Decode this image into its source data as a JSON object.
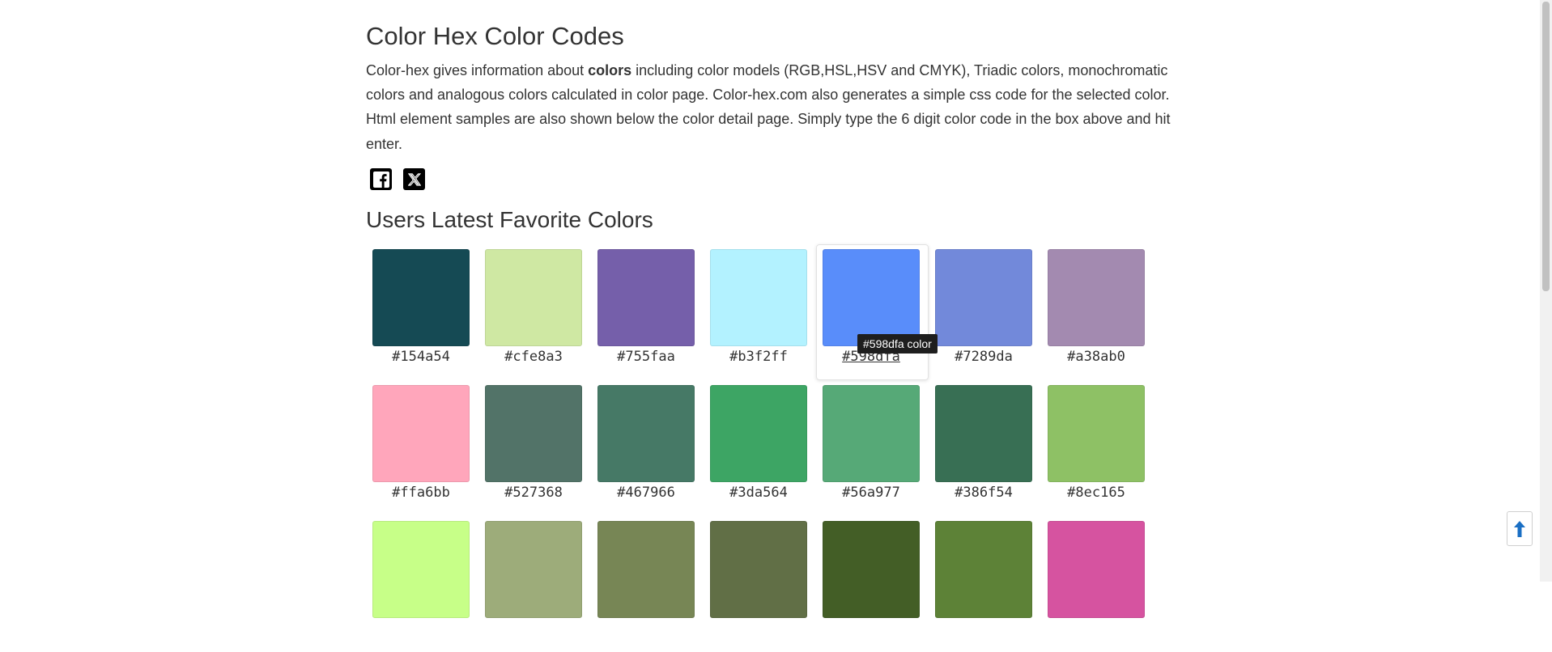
{
  "page": {
    "title": "Color Hex Color Codes",
    "intro_before": "Color-hex gives information about ",
    "intro_bold": "colors",
    "intro_after": " including color models (RGB,HSL,HSV and CMYK), Triadic colors, monochromatic colors and analogous colors calculated in color page. Color-hex.com also generates a simple css code for the selected color. Html element samples are also shown below the color detail page. Simply type the 6 digit color code in the box above and hit enter.",
    "favorites_title": "Users Latest Favorite Colors"
  },
  "social": [
    {
      "name": "facebook",
      "icon": "facebook-icon"
    },
    {
      "name": "x",
      "icon": "x-icon"
    }
  ],
  "colors": [
    {
      "hex": "#154a54"
    },
    {
      "hex": "#cfe8a3"
    },
    {
      "hex": "#755faa"
    },
    {
      "hex": "#b3f2ff"
    },
    {
      "hex": "#598dfa",
      "hovered": true
    },
    {
      "hex": "#7289da"
    },
    {
      "hex": "#a38ab0"
    },
    {
      "hex": "#ffa6bb"
    },
    {
      "hex": "#527368"
    },
    {
      "hex": "#467966"
    },
    {
      "hex": "#3da564"
    },
    {
      "hex": "#56a977"
    },
    {
      "hex": "#386f54"
    },
    {
      "hex": "#8ec165"
    },
    {
      "hex": "#c7ff88",
      "label_hidden": true
    },
    {
      "hex": "#9dac7a",
      "label_hidden": true
    },
    {
      "hex": "#778655",
      "label_hidden": true
    },
    {
      "hex": "#616f46",
      "label_hidden": true
    },
    {
      "hex": "#435e26",
      "label_hidden": true
    },
    {
      "hex": "#5d8237",
      "label_hidden": true
    },
    {
      "hex": "#d653a0",
      "label_hidden": true
    }
  ],
  "tooltip": {
    "text": "#598dfa color"
  },
  "back_to_top": {
    "icon": "arrow-up-icon",
    "color": "#1a6fc4"
  }
}
